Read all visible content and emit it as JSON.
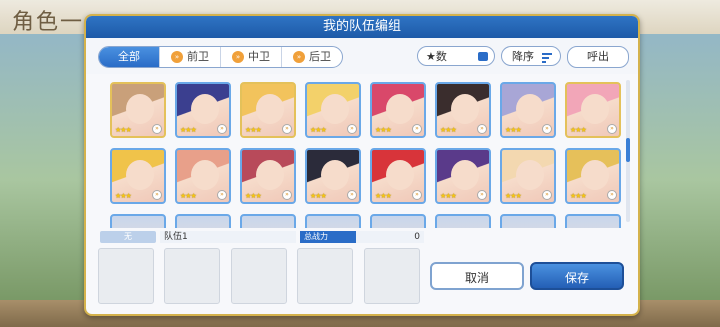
{
  "background": {
    "title": "角色一"
  },
  "dialog": {
    "title": "我的队伍编组"
  },
  "filter_tabs": [
    {
      "label": "全部",
      "icon": ""
    },
    {
      "label": "前卫",
      "icon": "chevron-right-icon"
    },
    {
      "label": "中卫",
      "icon": "chevron-right-icon"
    },
    {
      "label": "后卫",
      "icon": "chevron-right-icon"
    }
  ],
  "sort": {
    "stars_label": "★数",
    "order_label": "降序",
    "call_label": "呼出"
  },
  "cards_row1": [
    {
      "stars": "★★★",
      "hair": "#c9a07a",
      "frame": "gold"
    },
    {
      "stars": "★★★",
      "hair": "#3b3f8f",
      "frame": "blue"
    },
    {
      "stars": "★★★",
      "hair": "#f2c35c",
      "frame": "gold"
    },
    {
      "stars": "★★★",
      "hair": "#f3d16a",
      "frame": "blue"
    },
    {
      "stars": "★★★",
      "hair": "#d9486a",
      "frame": "blue"
    },
    {
      "stars": "★★★",
      "hair": "#3a2d2d",
      "frame": "blue"
    },
    {
      "stars": "★★★",
      "hair": "#a8a6d6",
      "frame": "blue"
    },
    {
      "stars": "★★★",
      "hair": "#f2a6b8",
      "frame": "gold"
    }
  ],
  "cards_row2": [
    {
      "stars": "★★★",
      "hair": "#f0c34a",
      "frame": "blue"
    },
    {
      "stars": "★★★",
      "hair": "#e8a08a",
      "frame": "blue"
    },
    {
      "stars": "★★★",
      "hair": "#b84a5a",
      "frame": "blue"
    },
    {
      "stars": "★★★",
      "hair": "#2b2b3a",
      "frame": "blue"
    },
    {
      "stars": "★★★",
      "hair": "#d8343a",
      "frame": "blue"
    },
    {
      "stars": "★★★",
      "hair": "#5a3a8a",
      "frame": "blue"
    },
    {
      "stars": "★★★",
      "hair": "#f3d8b0",
      "frame": "blue"
    },
    {
      "stars": "★★★",
      "hair": "#e6c05a",
      "frame": "blue"
    }
  ],
  "team": {
    "slot_label": "无",
    "name": "队伍1",
    "power_label": "总战力",
    "power_value": "0"
  },
  "buttons": {
    "cancel": "取消",
    "save": "保存"
  },
  "colors": {
    "primary_blue": "#2a6cc7",
    "gold_frame": "#e4c15a",
    "star": "#f3c417"
  }
}
